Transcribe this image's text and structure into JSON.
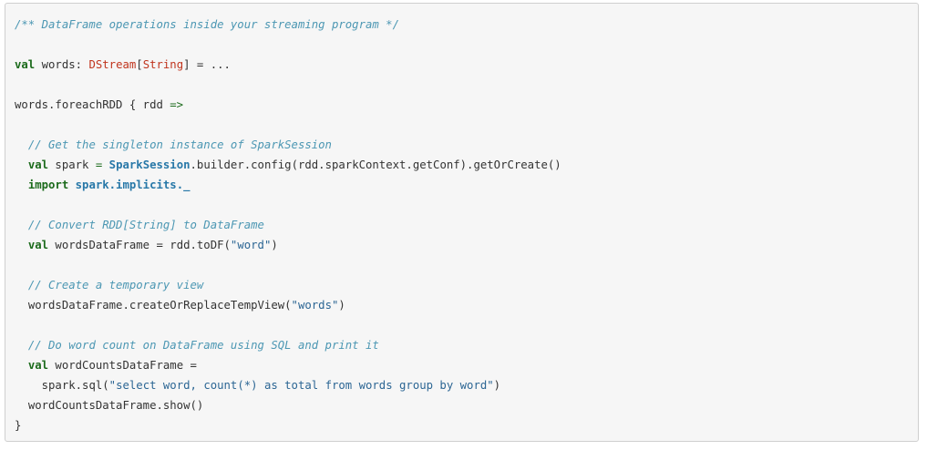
{
  "code_block": {
    "comment_header": "/** DataFrame operations inside your streaming program */",
    "line2": {
      "kw": "val",
      "ident": " words: ",
      "type": "DStream",
      "bracket_open": "[",
      "type_arg": "String",
      "bracket_close": "]",
      "rest": " = ..."
    },
    "line4": {
      "text": "words.foreachRDD { rdd ",
      "arrow": "=>"
    },
    "line6": {
      "comment": "// Get the singleton instance of SparkSession"
    },
    "line7": {
      "kw": "val",
      "ident": " spark ",
      "eq": "=",
      "space": " ",
      "cls": "SparkSession",
      "rest": ".builder.config(rdd.sparkContext.getConf).getOrCreate()"
    },
    "line8": {
      "kw": "import",
      "space": " ",
      "pkg": "spark.implicits._"
    },
    "line10": {
      "comment": "// Convert RDD[String] to DataFrame"
    },
    "line11": {
      "kw": "val",
      "rest": " wordsDataFrame = rdd.toDF(",
      "str": "\"word\"",
      "close": ")"
    },
    "line13": {
      "comment": "// Create a temporary view"
    },
    "line14": {
      "pre": "wordsDataFrame.createOrReplaceTempView(",
      "str": "\"words\"",
      "close": ")"
    },
    "line16": {
      "comment": "// Do word count on DataFrame using SQL and print it"
    },
    "line17": {
      "kw": "val",
      "rest": " wordCountsDataFrame ="
    },
    "line18": {
      "pre": "spark.sql(",
      "str": "\"select word, count(*) as total from words group by word\"",
      "close": ")"
    },
    "line19": {
      "text": "wordCountsDataFrame.show()"
    },
    "line20": {
      "text": "}"
    }
  }
}
